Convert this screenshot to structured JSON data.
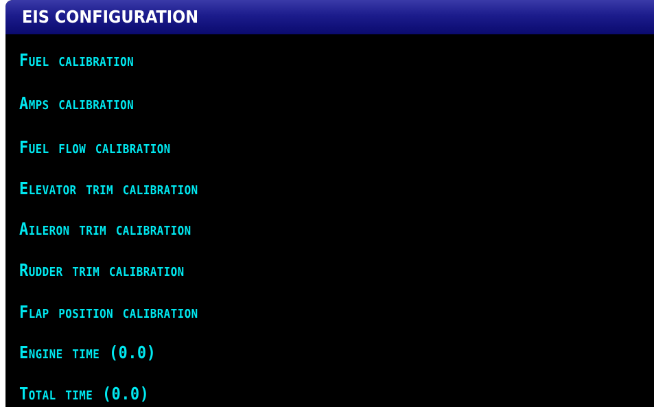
{
  "title_bar": {
    "title": "EIS CONFIGURATION"
  },
  "colors": {
    "title_bar_blue": "#1c1c8c",
    "menu_text_cyan": "#00e8f0",
    "background": "#000000"
  },
  "menu": {
    "items": [
      {
        "label": "Fuel Calibration"
      },
      {
        "label": "Amps Calibration"
      },
      {
        "label": "Fuel Flow Calibration"
      },
      {
        "label": "Elevator Trim Calibration"
      },
      {
        "label": "Aileron Trim Calibration"
      },
      {
        "label": "Rudder Trim Calibration"
      },
      {
        "label": "Flap Position Calibration"
      },
      {
        "label": "Engine Time (0.0)"
      },
      {
        "label": "Total Time (0.0)"
      }
    ]
  }
}
